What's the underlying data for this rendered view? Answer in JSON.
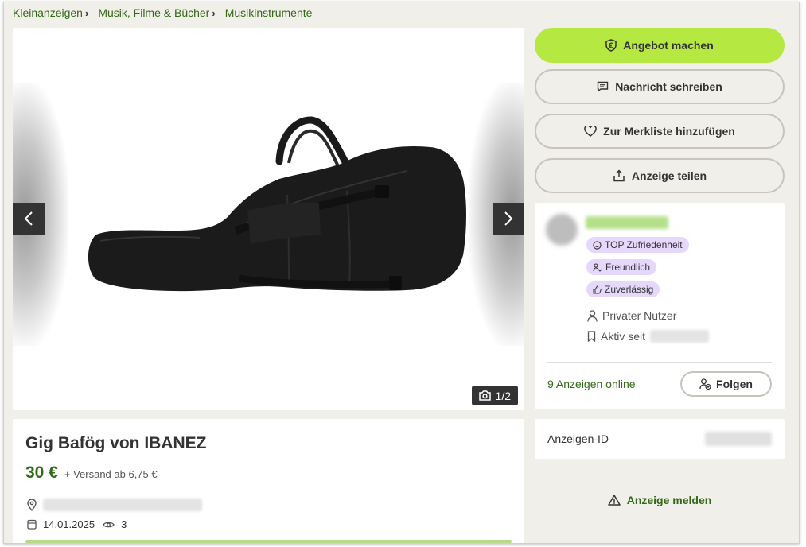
{
  "breadcrumb": [
    {
      "label": "Kleinanzeigen"
    },
    {
      "label": "Musik, Filme & Bücher"
    },
    {
      "label": "Musikinstrumente"
    }
  ],
  "gallery": {
    "photo_count": "1/2",
    "image_subject": "gig-bag-image"
  },
  "ad": {
    "title": "Gig Bafög von IBANEZ",
    "price": "30 €",
    "shipping": "+ Versand ab 6,75 €",
    "date": "14.01.2025",
    "views": "3"
  },
  "actions": {
    "offer": "Angebot machen",
    "message": "Nachricht schreiben",
    "watchlist": "Zur Merkliste hinzufügen",
    "share": "Anzeige teilen"
  },
  "seller": {
    "badges": [
      "TOP Zufriedenheit",
      "Freundlich",
      "Zuverlässig"
    ],
    "type": "Privater Nutzer",
    "active_since_label": "Aktiv seit",
    "ads_online": "9 Anzeigen online",
    "follow": "Folgen"
  },
  "ad_id": {
    "label": "Anzeigen-ID"
  },
  "report": "Anzeige melden",
  "colors": {
    "brand_green": "#326916",
    "primary_button": "#b5e941",
    "badge_bg": "#e6d8fb",
    "page_bg": "#f1efea"
  }
}
